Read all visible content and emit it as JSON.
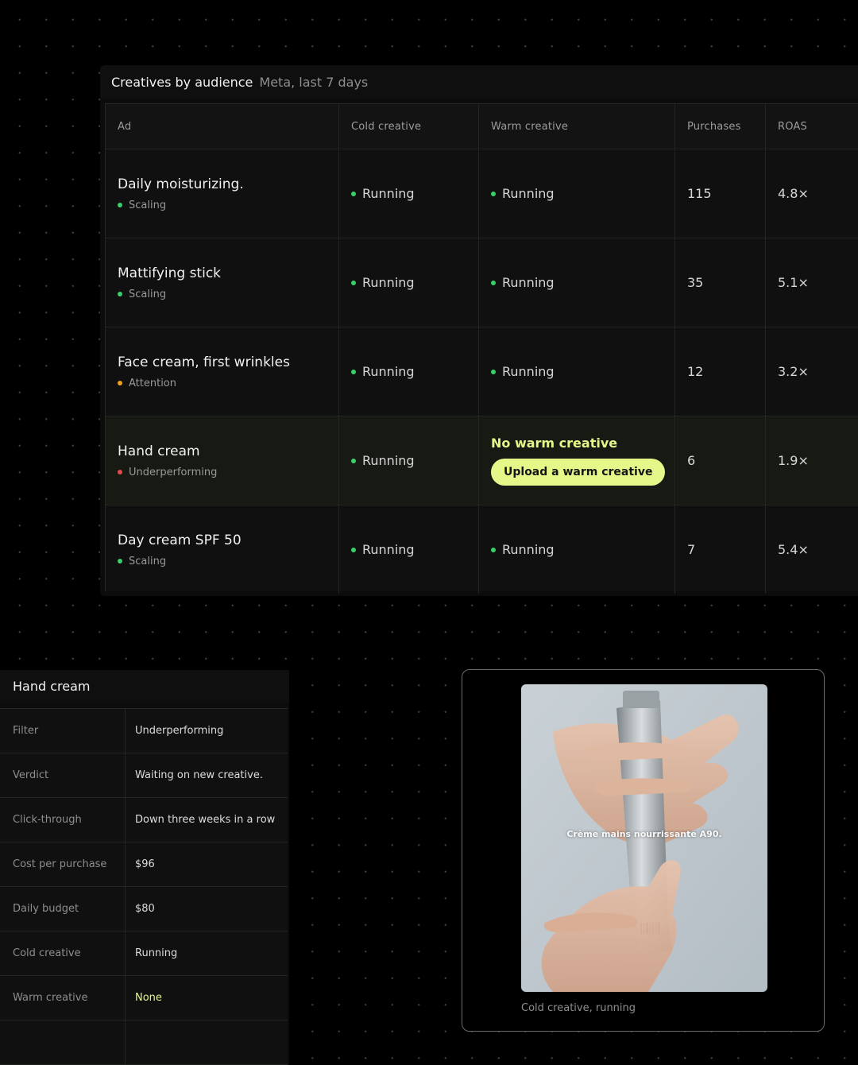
{
  "table": {
    "title": "Creatives by audience",
    "subtitle": "Meta, last 7 days",
    "headers": [
      "Ad",
      "Cold creative",
      "Warm creative",
      "Purchases",
      "ROAS"
    ],
    "rows": [
      {
        "name": "Daily moisturizing.",
        "status": "Scaling",
        "status_color": "#3ad06a",
        "cold": "Running",
        "warm": "Running",
        "purchases": "115",
        "roas": "4.8×"
      },
      {
        "name": "Mattifying stick",
        "status": "Scaling",
        "status_color": "#3ad06a",
        "cold": "Running",
        "warm": "Running",
        "purchases": "35",
        "roas": "5.1×"
      },
      {
        "name": "Face cream, first wrinkles",
        "status": "Attention",
        "status_color": "#f0a11f",
        "cold": "Running",
        "warm": "Running",
        "purchases": "12",
        "roas": "3.2×"
      },
      {
        "name": "Hand cream",
        "status": "Underperforming",
        "status_color": "#e5484d",
        "cold": "Running",
        "warm_missing": "No warm creative",
        "warm_action": "Upload a warm creative",
        "purchases": "6",
        "roas": "1.9×"
      },
      {
        "name": "Day cream SPF 50",
        "status": "Scaling",
        "status_color": "#3ad06a",
        "cold": "Running",
        "warm": "Running",
        "purchases": "7",
        "roas": "5.4×"
      }
    ]
  },
  "colors": {
    "running_dot": "#3ad06a",
    "accent_lime": "#e6f78a"
  },
  "detail": {
    "title": "Hand cream",
    "rows": [
      {
        "key": "Filter",
        "value": "Underperforming"
      },
      {
        "key": "Verdict",
        "value": "Waiting on new creative."
      },
      {
        "key": "Click-through",
        "value": "Down three weeks in a row"
      },
      {
        "key": "Cost per purchase",
        "value": "$96"
      },
      {
        "key": "Daily budget",
        "value": "$80"
      },
      {
        "key": "Cold creative",
        "value": "Running"
      },
      {
        "key": "Warm creative",
        "value": "None"
      }
    ]
  },
  "preview": {
    "overlay_text": "Crème mains nourrissante A90.",
    "caption": "Cold creative, running"
  }
}
